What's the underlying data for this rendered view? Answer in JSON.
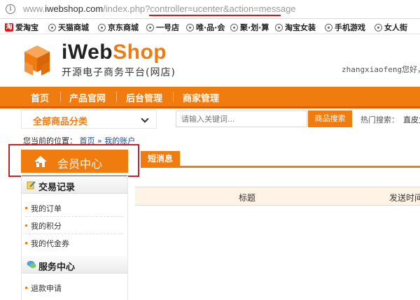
{
  "browser": {
    "url_prefix": "www.",
    "url_domain": "iwebshop.com",
    "url_path": "/index.php?",
    "url_query": "controller=ucenter&action=message",
    "info_glyph": "i"
  },
  "bookmarks": [
    {
      "label": "爱淘宝",
      "icon": "taobao-icon",
      "badge": "淘"
    },
    {
      "label": "天猫商城",
      "icon": "globe-icon"
    },
    {
      "label": "京东商城",
      "icon": "globe-icon"
    },
    {
      "label": "一号店",
      "icon": "globe-icon"
    },
    {
      "label": "唯·品·会",
      "icon": "globe-icon"
    },
    {
      "label": "聚·划·算",
      "icon": "globe-icon"
    },
    {
      "label": "淘宝女装",
      "icon": "globe-icon"
    },
    {
      "label": "手机游戏",
      "icon": "globe-icon"
    },
    {
      "label": "女人街",
      "icon": "globe-icon"
    }
  ],
  "header": {
    "brand_part1": "iWeb",
    "brand_part2": "Shop",
    "tagline": "开源电子商务平台(网店)",
    "welcome": "zhangxiaofeng您好，欢迎"
  },
  "nav": {
    "items": [
      "首页",
      "产品官网",
      "后台管理",
      "商家管理"
    ]
  },
  "search": {
    "category_label": "全部商品分类",
    "placeholder": "请输入关键词...",
    "button_label": "商品搜索",
    "hot_label": "热门搜索：",
    "hot_keyword": "直皮女"
  },
  "breadcrumb": {
    "prefix": "您当前的位置：",
    "home": "首页",
    "sep": "»",
    "current": "我的账户"
  },
  "sidebar": {
    "title": "会员中心",
    "groups": [
      {
        "title": "交易记录",
        "items": [
          "我的订单",
          "我的积分",
          "我的代金券"
        ]
      },
      {
        "title": "服务中心",
        "items": [
          "退款申请"
        ]
      }
    ]
  },
  "main": {
    "tab_label": "短消息",
    "columns": [
      "标题",
      "发送时间"
    ]
  },
  "colors": {
    "brand_orange": "#f07c0f",
    "highlight_red": "#c3222a"
  }
}
